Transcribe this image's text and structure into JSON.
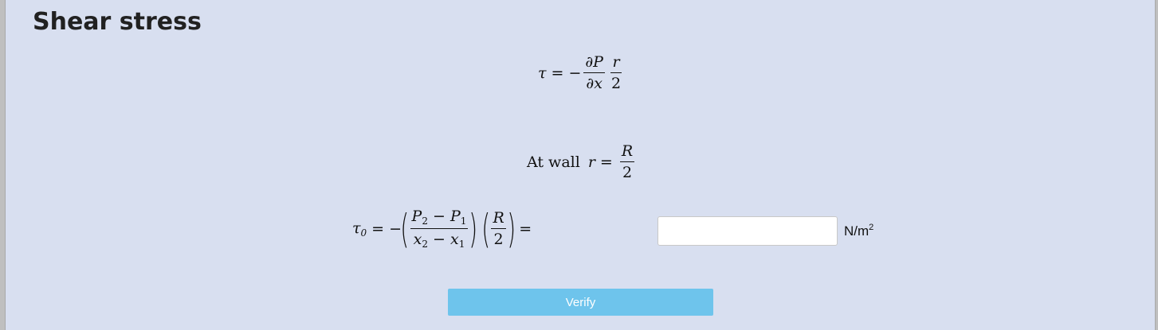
{
  "title": "Shear stress",
  "equation1": {
    "lhs": "τ",
    "eq": "=",
    "sign": "−",
    "frac1_num": "∂P",
    "frac1_den": "∂x",
    "frac2_num": "r",
    "frac2_den": "2"
  },
  "equation2": {
    "text": "At wall",
    "lhs": "r",
    "eq": "=",
    "frac_num": "R",
    "frac_den": "2"
  },
  "equation3": {
    "lhs": "τ",
    "lhs_sub": "0",
    "eq": "=",
    "sign": "−",
    "open": "(",
    "close": ")",
    "num_a": "P",
    "num_a_sub": "2",
    "minus": "−",
    "num_b": "P",
    "num_b_sub": "1",
    "den_a": "x",
    "den_a_sub": "2",
    "den_b": "x",
    "den_b_sub": "1",
    "frac2_num": "R",
    "frac2_den": "2",
    "trailing_eq": "="
  },
  "answer": {
    "value": "",
    "placeholder": ""
  },
  "unit": {
    "base": "N/m",
    "exponent": "2"
  },
  "verify_label": "Verify"
}
